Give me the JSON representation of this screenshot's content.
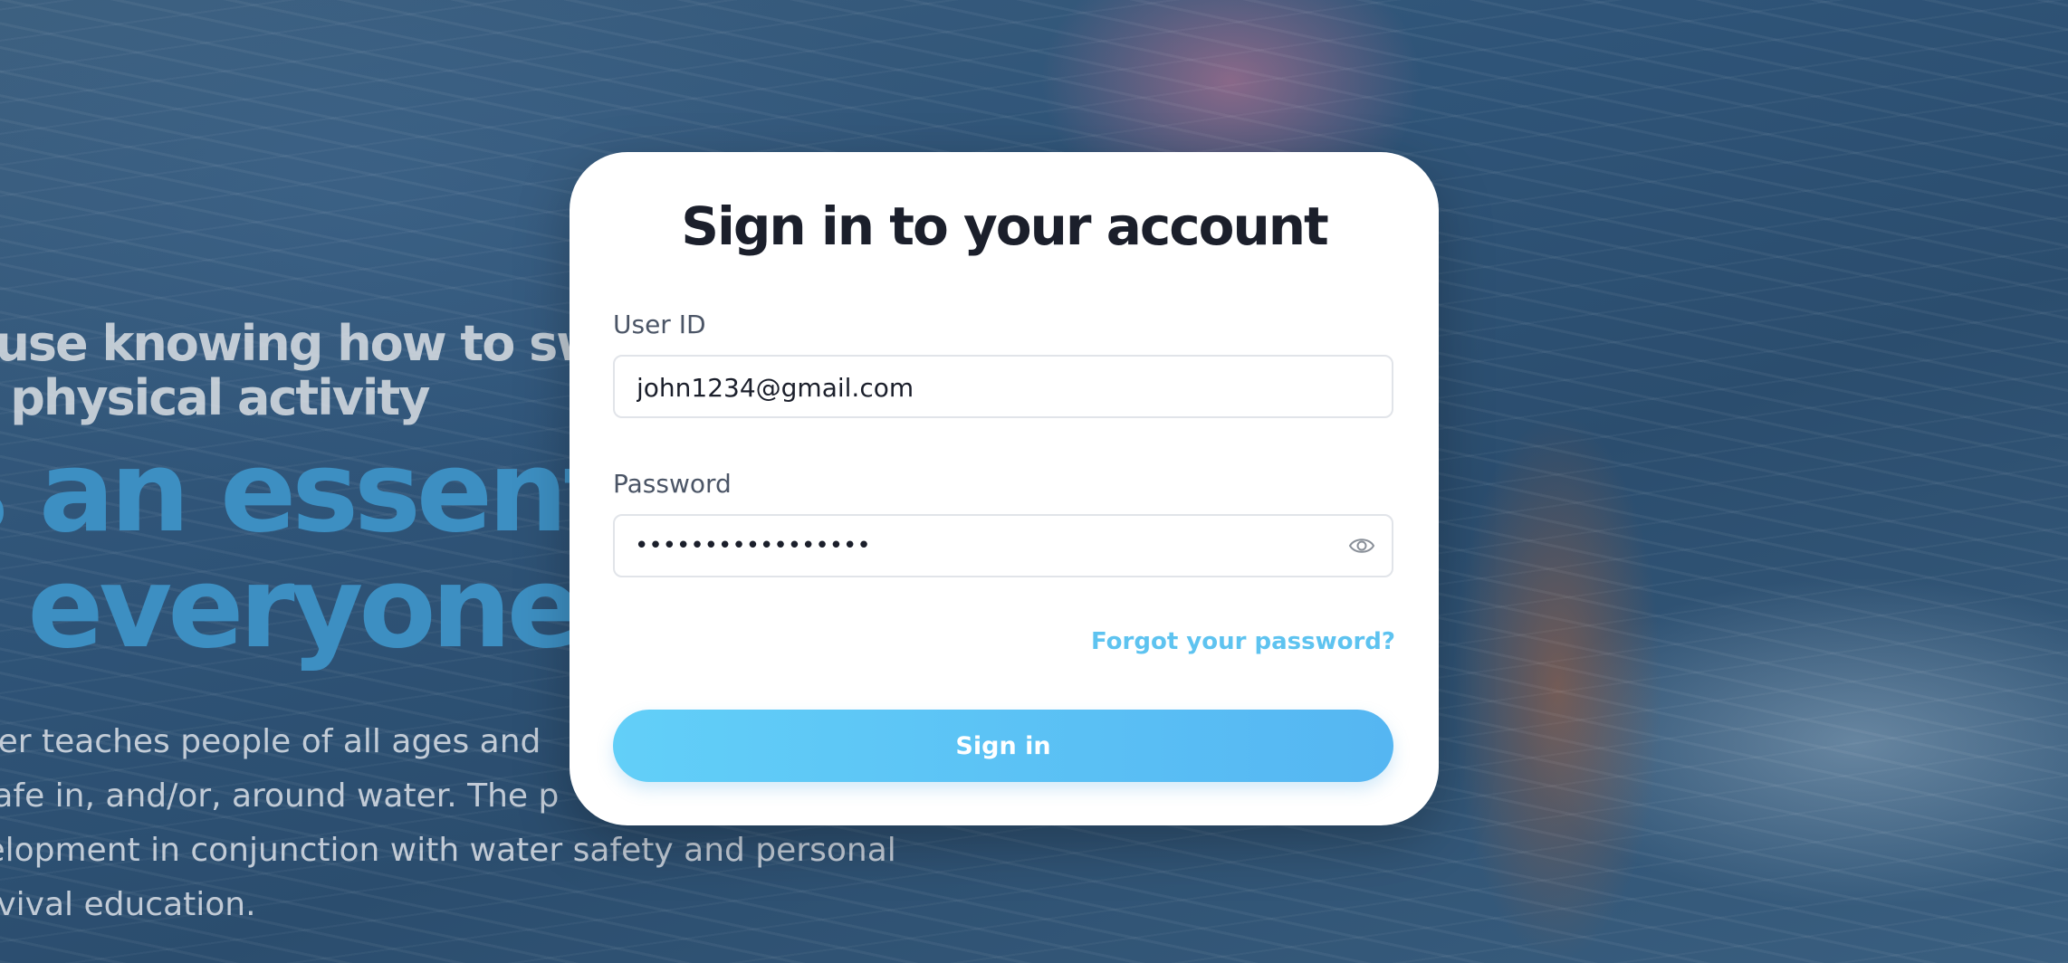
{
  "hero": {
    "subtitle_line1": "ause knowing how to swi",
    "subtitle_line2": "a physical activity",
    "headline_line1": "s an essenti",
    "headline_line2": "r everyone.",
    "body_line1": "Safer teaches people of all ages and",
    "body_line2": "e safe in, and/or, around water. The p",
    "body_line3": "evelopment in conjunction with water safety and personal",
    "body_line4": " survival education."
  },
  "login": {
    "title": "Sign in to your account",
    "user_id_label": "User ID",
    "user_id_value": "john1234@gmail.com",
    "password_label": "Password",
    "password_masked": "•••••••••••••••••",
    "forgot_link": "Forgot your password?",
    "submit_label": "Sign in",
    "eye_icon": "eye-icon"
  },
  "colors": {
    "accent": "#5ec3f0",
    "button_start": "#62cff8",
    "button_end": "#55b6f2",
    "headline_blue": "#3d8fc2",
    "title_text": "#1b1f2b"
  }
}
